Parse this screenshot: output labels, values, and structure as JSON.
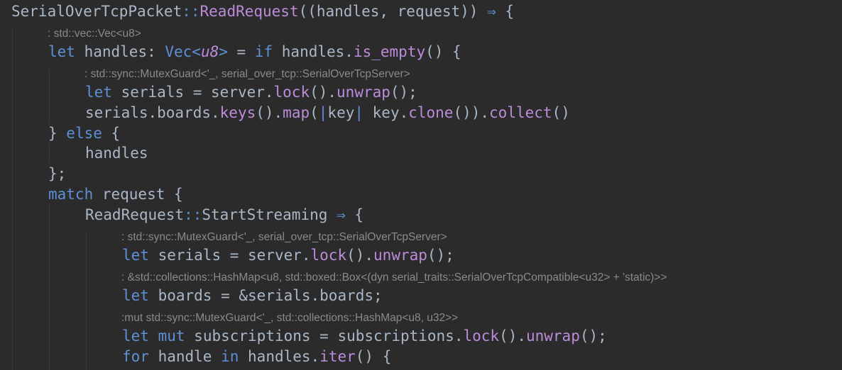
{
  "editor": {
    "lines": [
      {
        "id": "l1",
        "kind": "code",
        "tokens": [
          {
            "t": "SerialOverTcpPacket",
            "c": "pl"
          },
          {
            "t": "::",
            "c": "op"
          },
          {
            "t": "ReadRequest",
            "c": "fn"
          },
          {
            "t": "((handles, request)) ",
            "c": "pl"
          },
          {
            "t": "⇒",
            "c": "op"
          },
          {
            "t": " {",
            "c": "pl"
          }
        ]
      },
      {
        "id": "h1",
        "kind": "hint",
        "text": ": std::vec::Vec<u8>"
      },
      {
        "id": "l2",
        "kind": "code",
        "tokens": [
          {
            "t": "let",
            "c": "kw2"
          },
          {
            "t": " handles: ",
            "c": "pl"
          },
          {
            "t": "Vec<",
            "c": "kw2"
          },
          {
            "t": "u8",
            "c": "tp"
          },
          {
            "t": ">",
            "c": "kw2"
          },
          {
            "t": " = ",
            "c": "pl"
          },
          {
            "t": "if",
            "c": "kw2"
          },
          {
            "t": " handles.",
            "c": "pl"
          },
          {
            "t": "is_empty",
            "c": "fn"
          },
          {
            "t": "() {",
            "c": "pl"
          }
        ]
      },
      {
        "id": "h2",
        "kind": "hint",
        "text": ": std::sync::MutexGuard<'_, serial_over_tcp::SerialOverTcpServer>"
      },
      {
        "id": "l3",
        "kind": "code",
        "tokens": [
          {
            "t": "let",
            "c": "kw2"
          },
          {
            "t": " serials = server.",
            "c": "pl"
          },
          {
            "t": "lock",
            "c": "fn"
          },
          {
            "t": "().",
            "c": "pl"
          },
          {
            "t": "unwrap",
            "c": "fn"
          },
          {
            "t": "();",
            "c": "pl"
          }
        ]
      },
      {
        "id": "l4",
        "kind": "code",
        "tokens": [
          {
            "t": "serials.boards.",
            "c": "pl"
          },
          {
            "t": "keys",
            "c": "fn"
          },
          {
            "t": "().",
            "c": "pl"
          },
          {
            "t": "map",
            "c": "fn"
          },
          {
            "t": "(",
            "c": "pl"
          },
          {
            "t": "|",
            "c": "pipe"
          },
          {
            "t": "key",
            "c": "pl"
          },
          {
            "t": "|",
            "c": "pipe"
          },
          {
            "t": " key.",
            "c": "pl"
          },
          {
            "t": "clone",
            "c": "fn"
          },
          {
            "t": "()).",
            "c": "pl"
          },
          {
            "t": "collect",
            "c": "fn"
          },
          {
            "t": "()",
            "c": "pl"
          }
        ]
      },
      {
        "id": "l5",
        "kind": "code",
        "tokens": [
          {
            "t": "} ",
            "c": "pl"
          },
          {
            "t": "else",
            "c": "kw2"
          },
          {
            "t": " {",
            "c": "pl"
          }
        ]
      },
      {
        "id": "l6",
        "kind": "code",
        "tokens": [
          {
            "t": "handles",
            "c": "pl"
          }
        ]
      },
      {
        "id": "l7",
        "kind": "code",
        "tokens": [
          {
            "t": "};",
            "c": "pl"
          }
        ]
      },
      {
        "id": "l8",
        "kind": "code",
        "tokens": [
          {
            "t": "match",
            "c": "kw2"
          },
          {
            "t": " request {",
            "c": "pl"
          }
        ]
      },
      {
        "id": "l9",
        "kind": "code",
        "tokens": [
          {
            "t": "ReadRequest",
            "c": "pl"
          },
          {
            "t": "::",
            "c": "op"
          },
          {
            "t": "StartStreaming",
            "c": "pl"
          },
          {
            "t": " ",
            "c": "pl"
          },
          {
            "t": "⇒",
            "c": "op"
          },
          {
            "t": " {",
            "c": "pl"
          }
        ]
      },
      {
        "id": "h3",
        "kind": "hint",
        "text": ": std::sync::MutexGuard<'_, serial_over_tcp::SerialOverTcpServer>"
      },
      {
        "id": "l10",
        "kind": "code",
        "tokens": [
          {
            "t": "let",
            "c": "kw2"
          },
          {
            "t": " serials = server.",
            "c": "pl"
          },
          {
            "t": "lock",
            "c": "fn"
          },
          {
            "t": "().",
            "c": "pl"
          },
          {
            "t": "unwrap",
            "c": "fn"
          },
          {
            "t": "();",
            "c": "pl"
          }
        ]
      },
      {
        "id": "h4",
        "kind": "hint",
        "text": ": &std::collections::HashMap<u8, std::boxed::Box<(dyn serial_traits::SerialOverTcpCompatible<u32> + 'static)>>"
      },
      {
        "id": "l11",
        "kind": "code",
        "tokens": [
          {
            "t": "let",
            "c": "kw2"
          },
          {
            "t": " boards = &serials.boards;",
            "c": "pl"
          }
        ]
      },
      {
        "id": "h5",
        "kind": "hint",
        "text": ":mut std::sync::MutexGuard<'_, std::collections::HashMap<u8, u32>>"
      },
      {
        "id": "l12",
        "kind": "code",
        "tokens": [
          {
            "t": "let",
            "c": "kw2"
          },
          {
            "t": " ",
            "c": "pl"
          },
          {
            "t": "mut",
            "c": "kw2"
          },
          {
            "t": " subscriptions = subscriptions.",
            "c": "pl"
          },
          {
            "t": "lock",
            "c": "fn"
          },
          {
            "t": "().",
            "c": "pl"
          },
          {
            "t": "unwrap",
            "c": "fn"
          },
          {
            "t": "();",
            "c": "pl"
          }
        ]
      },
      {
        "id": "l13",
        "kind": "code",
        "tokens": [
          {
            "t": "for",
            "c": "kw2"
          },
          {
            "t": " handle ",
            "c": "pl"
          },
          {
            "t": "in",
            "c": "kw2"
          },
          {
            "t": " handles.",
            "c": "pl"
          },
          {
            "t": "iter",
            "c": "fn"
          },
          {
            "t": "() {",
            "c": "pl"
          }
        ]
      }
    ]
  }
}
